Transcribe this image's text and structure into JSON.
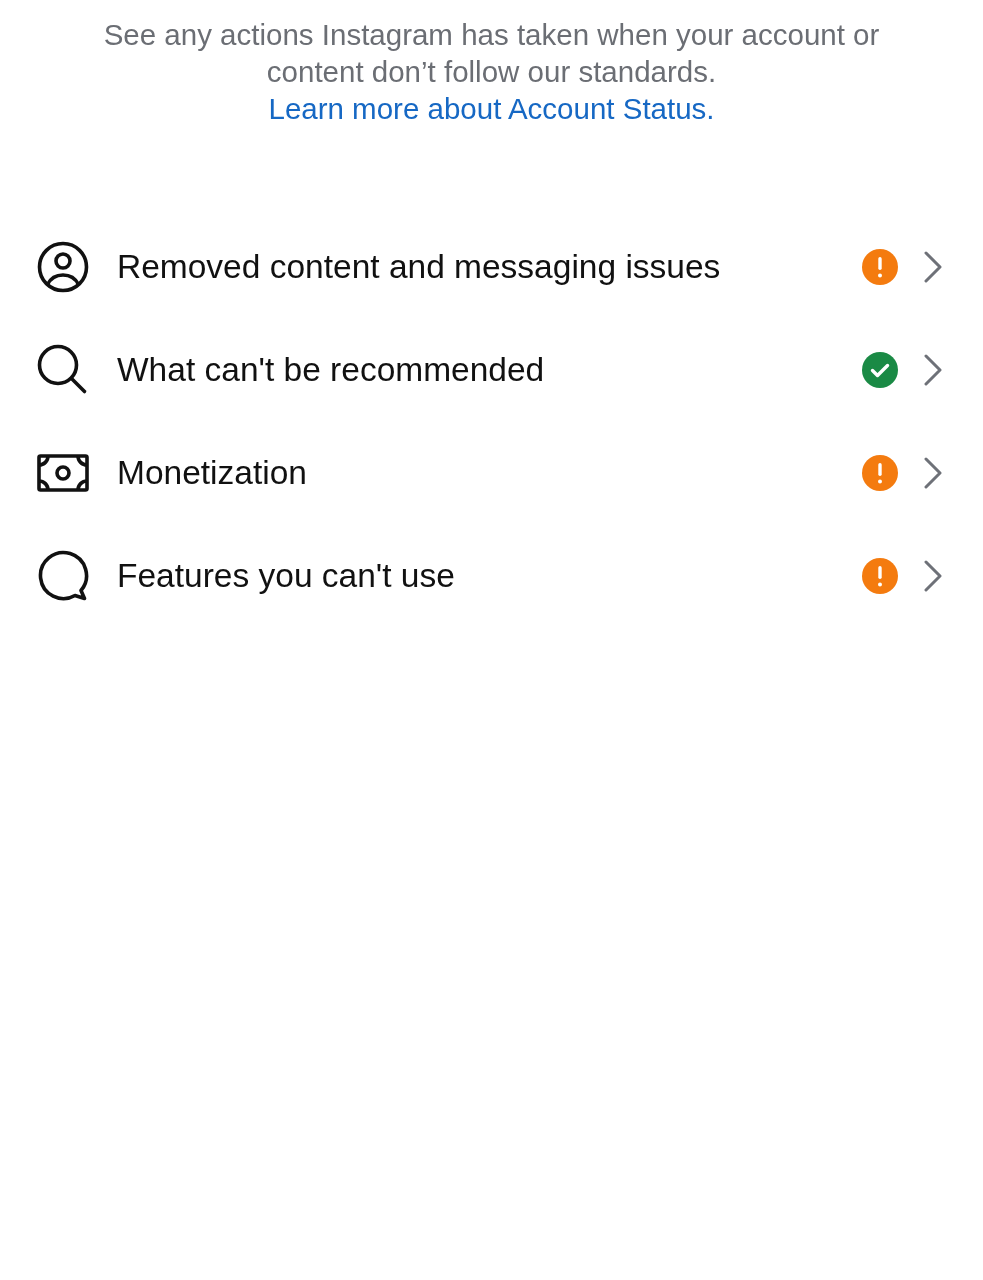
{
  "intro": {
    "text": "See any actions Instagram has taken when your account or content don’t follow our standards.",
    "link": "Learn more about Account Status."
  },
  "items": [
    {
      "label": "Removed content and messaging issues",
      "kind": "warning"
    },
    {
      "label": "What can't be recommended",
      "kind": "ok"
    },
    {
      "label": "Monetization",
      "kind": "warning"
    },
    {
      "label": "Features you can't use",
      "kind": "warning"
    }
  ]
}
